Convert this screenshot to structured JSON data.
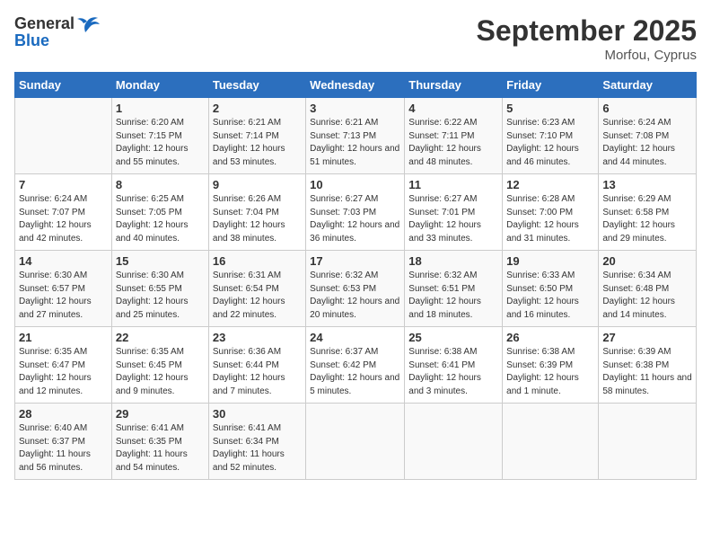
{
  "logo": {
    "general": "General",
    "blue": "Blue"
  },
  "title": "September 2025",
  "location": "Morfou, Cyprus",
  "days_header": [
    "Sunday",
    "Monday",
    "Tuesday",
    "Wednesday",
    "Thursday",
    "Friday",
    "Saturday"
  ],
  "weeks": [
    [
      {
        "day": "",
        "sunrise": "",
        "sunset": "",
        "daylight": ""
      },
      {
        "day": "1",
        "sunrise": "Sunrise: 6:20 AM",
        "sunset": "Sunset: 7:15 PM",
        "daylight": "Daylight: 12 hours and 55 minutes."
      },
      {
        "day": "2",
        "sunrise": "Sunrise: 6:21 AM",
        "sunset": "Sunset: 7:14 PM",
        "daylight": "Daylight: 12 hours and 53 minutes."
      },
      {
        "day": "3",
        "sunrise": "Sunrise: 6:21 AM",
        "sunset": "Sunset: 7:13 PM",
        "daylight": "Daylight: 12 hours and 51 minutes."
      },
      {
        "day": "4",
        "sunrise": "Sunrise: 6:22 AM",
        "sunset": "Sunset: 7:11 PM",
        "daylight": "Daylight: 12 hours and 48 minutes."
      },
      {
        "day": "5",
        "sunrise": "Sunrise: 6:23 AM",
        "sunset": "Sunset: 7:10 PM",
        "daylight": "Daylight: 12 hours and 46 minutes."
      },
      {
        "day": "6",
        "sunrise": "Sunrise: 6:24 AM",
        "sunset": "Sunset: 7:08 PM",
        "daylight": "Daylight: 12 hours and 44 minutes."
      }
    ],
    [
      {
        "day": "7",
        "sunrise": "Sunrise: 6:24 AM",
        "sunset": "Sunset: 7:07 PM",
        "daylight": "Daylight: 12 hours and 42 minutes."
      },
      {
        "day": "8",
        "sunrise": "Sunrise: 6:25 AM",
        "sunset": "Sunset: 7:05 PM",
        "daylight": "Daylight: 12 hours and 40 minutes."
      },
      {
        "day": "9",
        "sunrise": "Sunrise: 6:26 AM",
        "sunset": "Sunset: 7:04 PM",
        "daylight": "Daylight: 12 hours and 38 minutes."
      },
      {
        "day": "10",
        "sunrise": "Sunrise: 6:27 AM",
        "sunset": "Sunset: 7:03 PM",
        "daylight": "Daylight: 12 hours and 36 minutes."
      },
      {
        "day": "11",
        "sunrise": "Sunrise: 6:27 AM",
        "sunset": "Sunset: 7:01 PM",
        "daylight": "Daylight: 12 hours and 33 minutes."
      },
      {
        "day": "12",
        "sunrise": "Sunrise: 6:28 AM",
        "sunset": "Sunset: 7:00 PM",
        "daylight": "Daylight: 12 hours and 31 minutes."
      },
      {
        "day": "13",
        "sunrise": "Sunrise: 6:29 AM",
        "sunset": "Sunset: 6:58 PM",
        "daylight": "Daylight: 12 hours and 29 minutes."
      }
    ],
    [
      {
        "day": "14",
        "sunrise": "Sunrise: 6:30 AM",
        "sunset": "Sunset: 6:57 PM",
        "daylight": "Daylight: 12 hours and 27 minutes."
      },
      {
        "day": "15",
        "sunrise": "Sunrise: 6:30 AM",
        "sunset": "Sunset: 6:55 PM",
        "daylight": "Daylight: 12 hours and 25 minutes."
      },
      {
        "day": "16",
        "sunrise": "Sunrise: 6:31 AM",
        "sunset": "Sunset: 6:54 PM",
        "daylight": "Daylight: 12 hours and 22 minutes."
      },
      {
        "day": "17",
        "sunrise": "Sunrise: 6:32 AM",
        "sunset": "Sunset: 6:53 PM",
        "daylight": "Daylight: 12 hours and 20 minutes."
      },
      {
        "day": "18",
        "sunrise": "Sunrise: 6:32 AM",
        "sunset": "Sunset: 6:51 PM",
        "daylight": "Daylight: 12 hours and 18 minutes."
      },
      {
        "day": "19",
        "sunrise": "Sunrise: 6:33 AM",
        "sunset": "Sunset: 6:50 PM",
        "daylight": "Daylight: 12 hours and 16 minutes."
      },
      {
        "day": "20",
        "sunrise": "Sunrise: 6:34 AM",
        "sunset": "Sunset: 6:48 PM",
        "daylight": "Daylight: 12 hours and 14 minutes."
      }
    ],
    [
      {
        "day": "21",
        "sunrise": "Sunrise: 6:35 AM",
        "sunset": "Sunset: 6:47 PM",
        "daylight": "Daylight: 12 hours and 12 minutes."
      },
      {
        "day": "22",
        "sunrise": "Sunrise: 6:35 AM",
        "sunset": "Sunset: 6:45 PM",
        "daylight": "Daylight: 12 hours and 9 minutes."
      },
      {
        "day": "23",
        "sunrise": "Sunrise: 6:36 AM",
        "sunset": "Sunset: 6:44 PM",
        "daylight": "Daylight: 12 hours and 7 minutes."
      },
      {
        "day": "24",
        "sunrise": "Sunrise: 6:37 AM",
        "sunset": "Sunset: 6:42 PM",
        "daylight": "Daylight: 12 hours and 5 minutes."
      },
      {
        "day": "25",
        "sunrise": "Sunrise: 6:38 AM",
        "sunset": "Sunset: 6:41 PM",
        "daylight": "Daylight: 12 hours and 3 minutes."
      },
      {
        "day": "26",
        "sunrise": "Sunrise: 6:38 AM",
        "sunset": "Sunset: 6:39 PM",
        "daylight": "Daylight: 12 hours and 1 minute."
      },
      {
        "day": "27",
        "sunrise": "Sunrise: 6:39 AM",
        "sunset": "Sunset: 6:38 PM",
        "daylight": "Daylight: 11 hours and 58 minutes."
      }
    ],
    [
      {
        "day": "28",
        "sunrise": "Sunrise: 6:40 AM",
        "sunset": "Sunset: 6:37 PM",
        "daylight": "Daylight: 11 hours and 56 minutes."
      },
      {
        "day": "29",
        "sunrise": "Sunrise: 6:41 AM",
        "sunset": "Sunset: 6:35 PM",
        "daylight": "Daylight: 11 hours and 54 minutes."
      },
      {
        "day": "30",
        "sunrise": "Sunrise: 6:41 AM",
        "sunset": "Sunset: 6:34 PM",
        "daylight": "Daylight: 11 hours and 52 minutes."
      },
      {
        "day": "",
        "sunrise": "",
        "sunset": "",
        "daylight": ""
      },
      {
        "day": "",
        "sunrise": "",
        "sunset": "",
        "daylight": ""
      },
      {
        "day": "",
        "sunrise": "",
        "sunset": "",
        "daylight": ""
      },
      {
        "day": "",
        "sunrise": "",
        "sunset": "",
        "daylight": ""
      }
    ]
  ]
}
